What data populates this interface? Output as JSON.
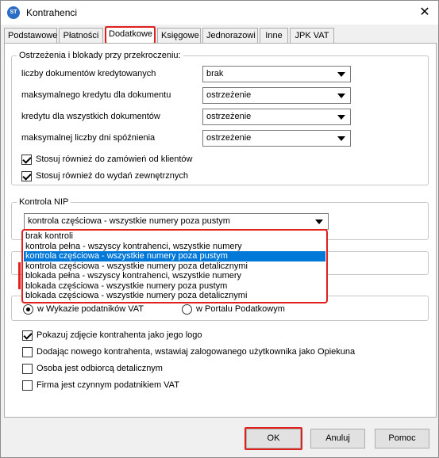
{
  "window": {
    "title": "Kontrahenci",
    "close_glyph": "✕",
    "app_icon_text": "ST"
  },
  "tabs": [
    {
      "label": "Podstawowe"
    },
    {
      "label": "Płatności"
    },
    {
      "label": "Dodatkowe",
      "active": true
    },
    {
      "label": "Księgowe"
    },
    {
      "label": "Jednorazowi"
    },
    {
      "label": "Inne"
    },
    {
      "label": "JPK VAT"
    }
  ],
  "warnings": {
    "title": "Ostrzeżenia i blokady przy przekroczeniu:",
    "rows": [
      {
        "label": "liczby dokumentów kredytowanych",
        "value": "brak"
      },
      {
        "label": "maksymalnego kredytu dla  dokumentu",
        "value": "ostrzeżenie"
      },
      {
        "label": "kredytu dla wszystkich dokumentów",
        "value": "ostrzeżenie"
      },
      {
        "label": "maksymalnej liczby dni spóźnienia",
        "value": "ostrzeżenie"
      }
    ],
    "checks": [
      {
        "label": "Stosuj również do zamówień od klientów",
        "checked": true
      },
      {
        "label": "Stosuj również do wydań zewnętrznych",
        "checked": true
      }
    ]
  },
  "nip": {
    "title": "Kontrola NIP",
    "selected": "kontrola częściowa - wszystkie numery poza pustym",
    "options": [
      "brak kontroli",
      "kontrola pełna - wszyscy kontrahenci, wszystkie numery",
      "kontrola częściowa - wszystkie numery poza pustym",
      "kontrola częściowa - wszystkie numery poza detalicznymi",
      "blokada pełna - wszyscy kontrahenci, wszystkie numery",
      "blokada częściowa - wszystkie numery poza pustym",
      "blokada częściowa - wszystkie numery poza detalicznymi"
    ],
    "selected_index": 2
  },
  "verify": {
    "options": [
      {
        "label": "w Wykazie podatników VAT",
        "checked": true
      },
      {
        "label": "w Portalu Podatkowym",
        "checked": false
      }
    ]
  },
  "extra_checks": [
    {
      "label": "Pokazuj zdjęcie kontrahenta jako jego logo",
      "checked": true
    },
    {
      "label": "Dodając nowego kontrahenta, wstawiaj zalogowanego użytkownika jako Opiekuna",
      "checked": false
    },
    {
      "label": "Osoba jest odbiorcą detalicznym",
      "checked": false
    },
    {
      "label": "Firma jest czynnym podatnikiem VAT",
      "checked": false
    }
  ],
  "buttons": {
    "ok": "OK",
    "cancel": "Anuluj",
    "help": "Pomoc"
  },
  "colors": {
    "highlight_red": "#e0201c",
    "selection_blue": "#0078d7"
  }
}
